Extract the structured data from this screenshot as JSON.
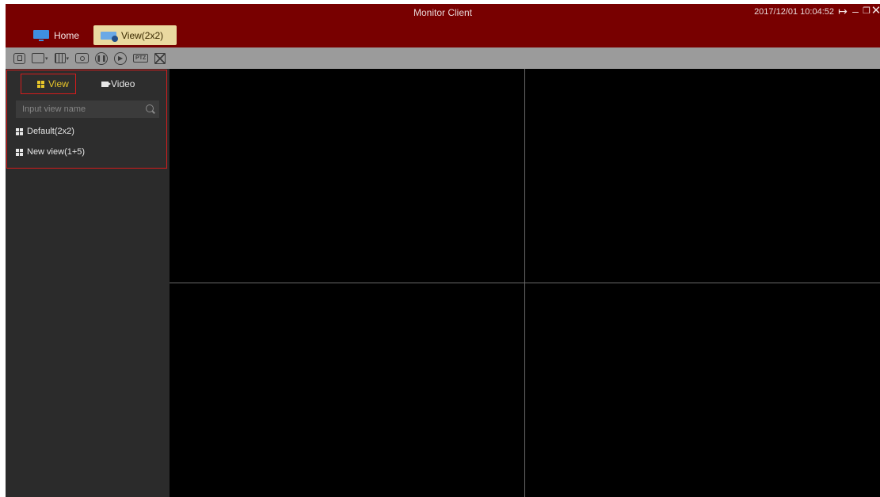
{
  "window": {
    "title": "Monitor Client",
    "datetime": "2017/12/01 10:04:52",
    "controls": [
      "exit-icon",
      "minimize-icon",
      "restore-icon",
      "close-icon"
    ]
  },
  "tabs": [
    {
      "label": "Home",
      "icon": "monitor-icon",
      "active": false
    },
    {
      "label": "View(2x2)",
      "icon": "view-icon",
      "active": true
    }
  ],
  "toolbar": {
    "buttons": [
      "sequence-icon",
      "window-layout-icon",
      "grid-layout-icon",
      "snapshot-icon",
      "pause-icon",
      "play-icon",
      "ptz-icon",
      "fullscreen-icon"
    ],
    "ptz_label": "PTZ"
  },
  "sidebar": {
    "tabs": [
      {
        "label": "View",
        "active": true
      },
      {
        "label": "Video",
        "active": false
      }
    ],
    "search": {
      "placeholder": "Input view name",
      "value": ""
    },
    "views": [
      {
        "label": "Default(2x2)"
      },
      {
        "label": "New view(1+5)"
      }
    ]
  },
  "colors": {
    "titlebar": "#780000",
    "active_tab": "#ead9a0",
    "toolbar": "#9b9b9b",
    "sidebar": "#2b2b2b",
    "highlight_border": "#d41c1c",
    "active_text": "#e8c62a"
  }
}
